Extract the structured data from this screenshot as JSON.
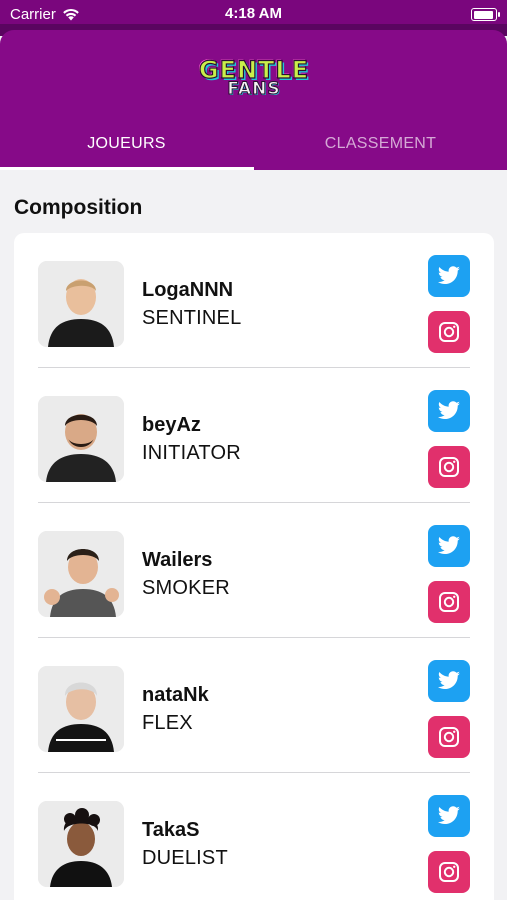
{
  "status_bar": {
    "carrier": "Carrier",
    "time": "4:18 AM"
  },
  "logo": {
    "line1": "GENTLE",
    "line2": "FANS"
  },
  "tabs": [
    {
      "label": "JOUEURS",
      "selected": true
    },
    {
      "label": "CLASSEMENT",
      "selected": false
    }
  ],
  "section_title": "Composition",
  "colors": {
    "header": "#860a88",
    "twitter": "#1da1f2",
    "instagram": "#e1306c"
  },
  "players": [
    {
      "name": "LogaNNN",
      "role": "SENTINEL",
      "hair": "#c9a070",
      "shirt": "#1b1b1b"
    },
    {
      "name": "beyAz",
      "role": "INITIATOR",
      "hair": "#2a1c14",
      "shirt": "#222222"
    },
    {
      "name": "Wailers",
      "role": "SMOKER",
      "hair": "#2b2018",
      "shirt": "#555555"
    },
    {
      "name": "nataNk",
      "role": "FLEX",
      "hair": "#d8d8d8",
      "shirt": "#141414"
    },
    {
      "name": "TakaS",
      "role": "DUELIST",
      "hair": "#161010",
      "shirt": "#111111"
    }
  ]
}
